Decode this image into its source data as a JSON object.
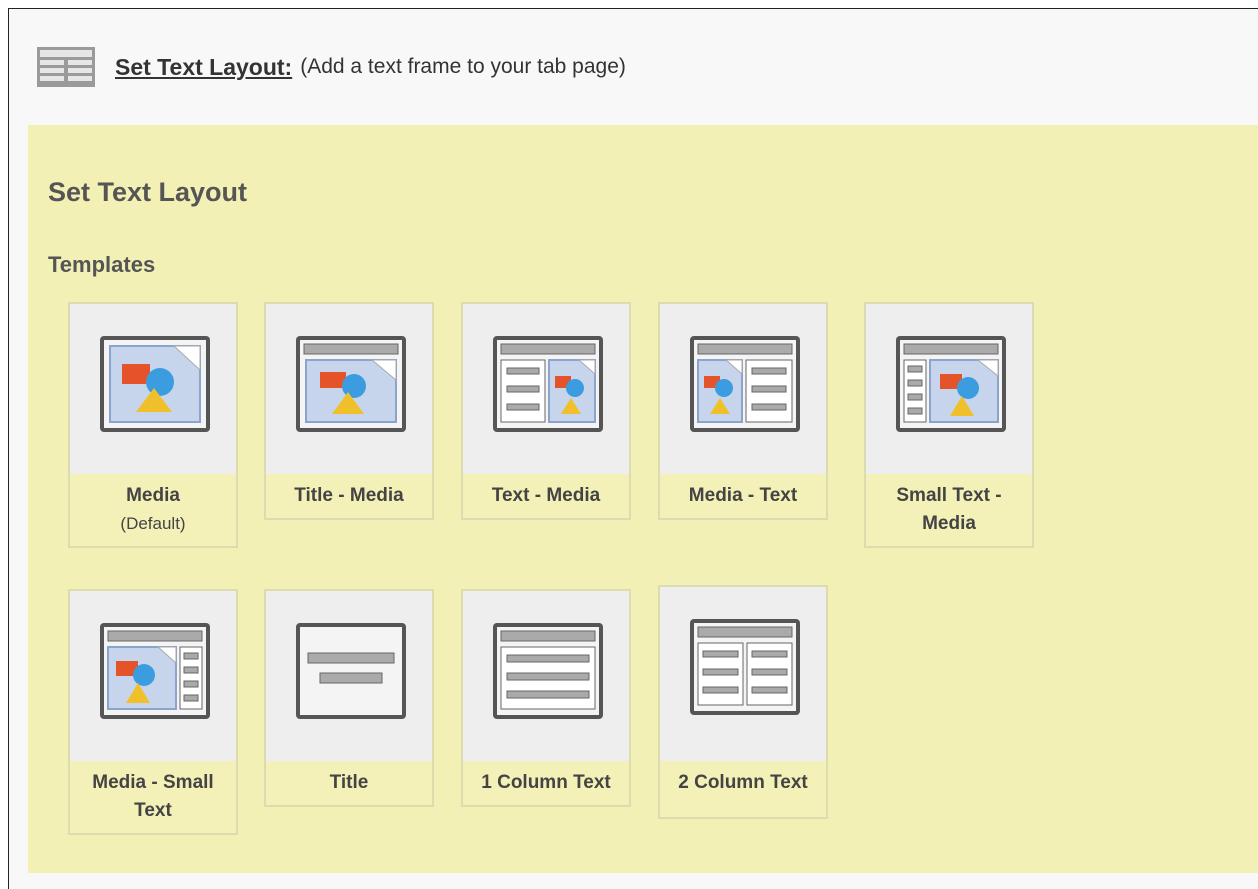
{
  "header": {
    "title": "Set Text Layout:",
    "subtitle": "(Add a text frame to your tab page)",
    "icon": "text-layout-icon"
  },
  "panel": {
    "title": "Set Text Layout",
    "templates_label": "Templates"
  },
  "templates": [
    {
      "label": "Media",
      "sub": "(Default)",
      "icon": "media-layout-icon"
    },
    {
      "label": "Title - Media",
      "icon": "title-media-layout-icon"
    },
    {
      "label": "Text - Media",
      "icon": "text-media-layout-icon"
    },
    {
      "label": "Media - Text",
      "icon": "media-text-layout-icon"
    },
    {
      "label": "Small Text - Media",
      "icon": "small-text-media-layout-icon"
    },
    {
      "label": "Media - Small Text",
      "icon": "media-small-text-layout-icon"
    },
    {
      "label": "Title",
      "icon": "title-layout-icon"
    },
    {
      "label": "1 Column Text",
      "icon": "one-column-text-layout-icon"
    },
    {
      "label": "2 Column Text",
      "icon": "two-column-text-layout-icon"
    }
  ],
  "colors": {
    "panel_bg": "#f2f0b4",
    "tile_img_bg": "#eeeeee"
  }
}
